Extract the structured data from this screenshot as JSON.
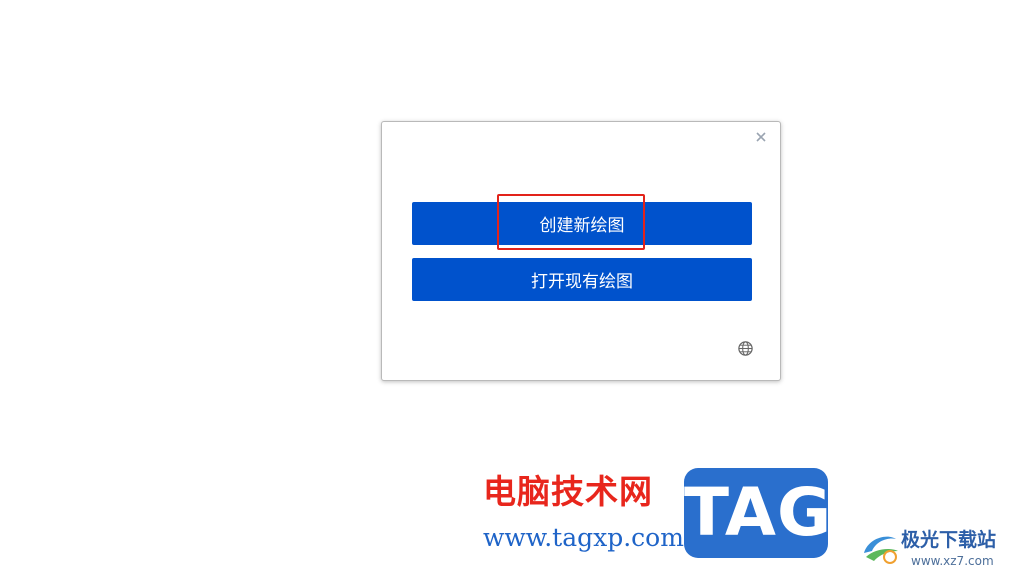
{
  "dialog": {
    "close_glyph": "×",
    "create_label": "创建新绘图",
    "open_label": "打开现有绘图",
    "language_icon": "globe-icon"
  },
  "colors": {
    "button_blue": "#0052cc",
    "highlight_red": "#e2231a"
  },
  "watermark": {
    "site_cn": "电脑技术网",
    "site_url": "www.tagxp.com",
    "tag_logo": "TAG",
    "brand_cn": "极光下载站",
    "brand_url": "www.xz7.com"
  }
}
